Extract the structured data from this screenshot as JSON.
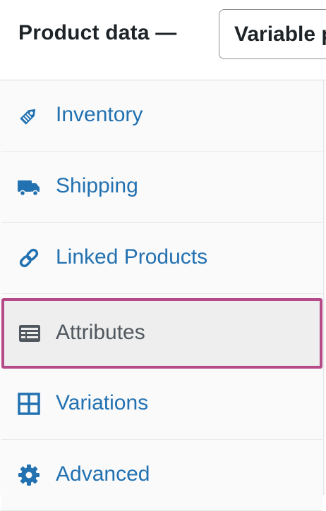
{
  "header": {
    "title": "Product data —",
    "product_type": "Variable product"
  },
  "tabs": [
    {
      "label": "Inventory",
      "icon": "tag-icon"
    },
    {
      "label": "Shipping",
      "icon": "truck-icon"
    },
    {
      "label": "Linked Products",
      "icon": "link-icon"
    },
    {
      "label": "Attributes",
      "icon": "list-view-icon",
      "active": true
    },
    {
      "label": "Variations",
      "icon": "grid-icon"
    },
    {
      "label": "Advanced",
      "icon": "gear-icon"
    }
  ],
  "colors": {
    "link": "#2271b1",
    "active_text": "#50575e",
    "highlight_border": "#b44b88",
    "panel_bg": "#fafafa",
    "active_bg": "#eeeeee"
  }
}
